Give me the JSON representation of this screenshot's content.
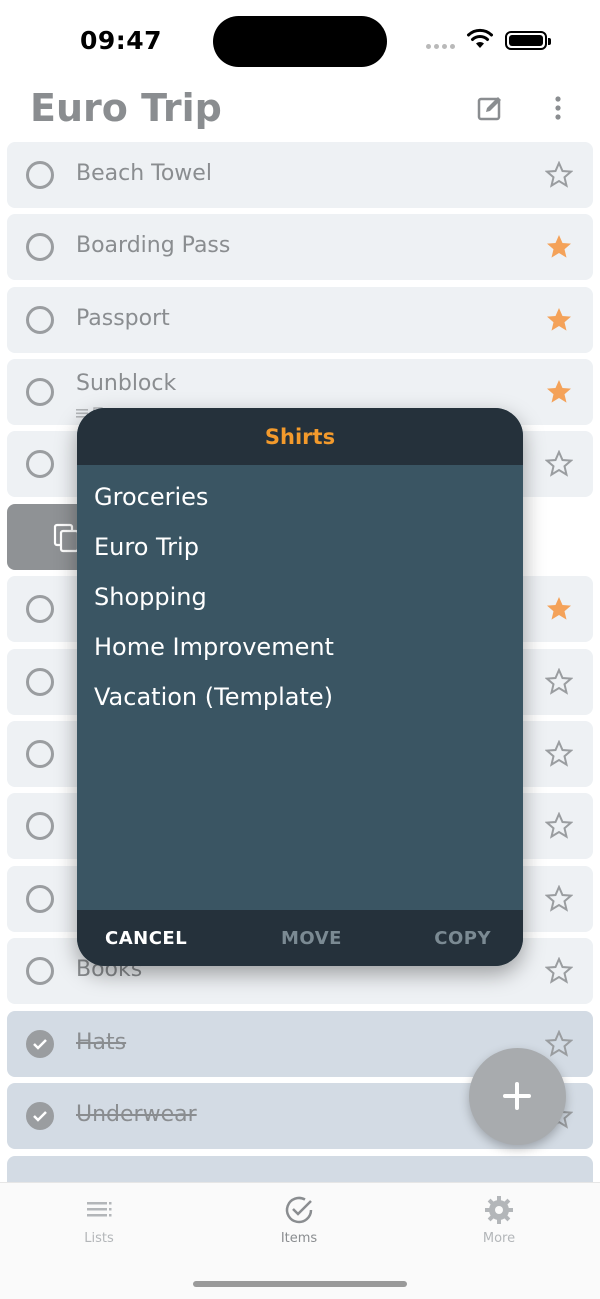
{
  "status_bar": {
    "time": "09:47"
  },
  "header": {
    "title": "Euro Trip"
  },
  "items": [
    {
      "name": "Beach Towel",
      "starred": false,
      "checked": false
    },
    {
      "name": "Boarding Pass",
      "starred": true,
      "checked": false
    },
    {
      "name": "Passport",
      "starred": true,
      "checked": false
    },
    {
      "name": "Sunblock",
      "starred": true,
      "checked": false
    },
    {
      "name": "",
      "starred": false,
      "checked": false
    },
    {
      "name": "",
      "starred": true,
      "checked": false
    },
    {
      "name": "",
      "starred": false,
      "checked": false
    },
    {
      "name": "",
      "starred": false,
      "checked": false
    },
    {
      "name": "",
      "starred": false,
      "checked": false
    },
    {
      "name": "",
      "starred": false,
      "checked": false
    },
    {
      "name": "Books",
      "starred": false,
      "checked": false
    },
    {
      "name": "Hats",
      "starred": false,
      "checked": true
    },
    {
      "name": "Underwear",
      "starred": false,
      "checked": true
    }
  ],
  "dialog": {
    "title": "Shirts",
    "options": [
      "Groceries",
      "Euro Trip",
      "Shopping",
      "Home Improvement",
      "Vacation (Template)"
    ],
    "cancel_label": "CANCEL",
    "move_label": "MOVE",
    "copy_label": "COPY"
  },
  "tabbar": {
    "tabs": [
      {
        "label": "Lists",
        "icon": "list-icon"
      },
      {
        "label": "Items",
        "icon": "check-circle-icon"
      },
      {
        "label": "More",
        "icon": "gear-icon"
      }
    ]
  },
  "colors": {
    "accent": "#f39a2c",
    "dialog_bg": "#3a5563",
    "dialog_bar": "#25313b",
    "item_bg": "#eef1f4",
    "checked_item_bg": "#d3dbe4"
  }
}
